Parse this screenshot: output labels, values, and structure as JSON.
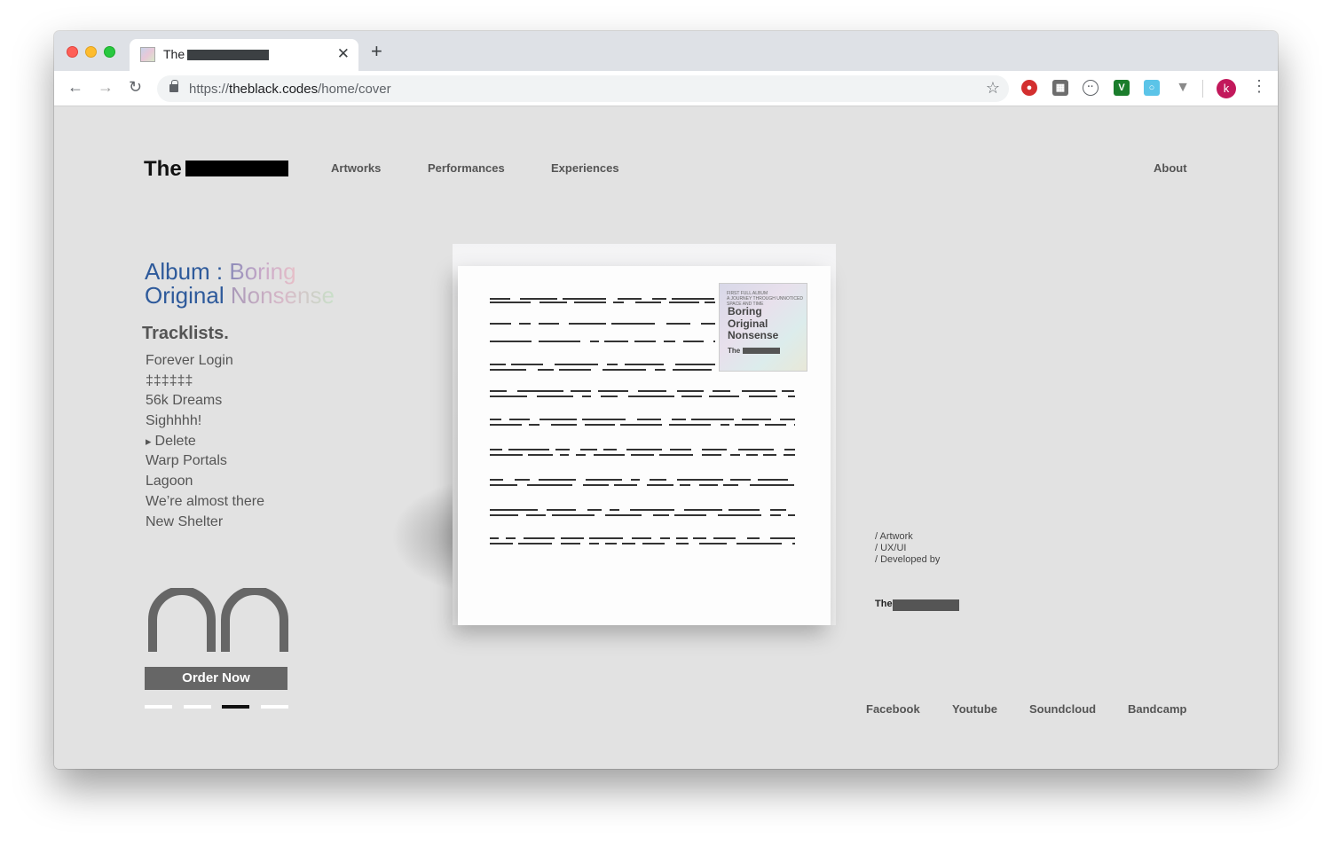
{
  "browser": {
    "tab_title": "The",
    "url_scheme": "https://",
    "url_host": "theblack.codes",
    "url_path": "/home/cover",
    "avatar_letter": "k"
  },
  "site": {
    "logo_text": "The",
    "nav": {
      "artworks": "Artworks",
      "performances": "Performances",
      "experiences": "Experiences",
      "about": "About"
    }
  },
  "album": {
    "label": "Album",
    "separator": " : ",
    "title_part1": "Boring",
    "title_part2": "Original",
    "title_part3": "Nonsense",
    "order_label": "Order Now"
  },
  "tracklist": {
    "heading": "Tracklists.",
    "tracks": [
      "Forever Login",
      "‡‡‡‡‡‡",
      "56k Dreams",
      "Sighhhh!",
      "Delete",
      "Warp Portals",
      "Lagoon",
      "We’re almost there",
      "New Shelter"
    ],
    "active_index": 4
  },
  "cover": {
    "sticker_line1": "FIRST FULL ALBUM",
    "sticker_line2": "A JOURNEY THROUGH UNNOTICED SPACE AND TIME",
    "sticker_title_1": "Boring",
    "sticker_title_2": "Original",
    "sticker_title_3": "Nonsense",
    "sticker_the": "The"
  },
  "credits": {
    "line1": "/ Artwork",
    "line2": "/ UX/UI",
    "line3": "/ Developed by",
    "the": "The"
  },
  "social": {
    "facebook": "Facebook",
    "youtube": "Youtube",
    "soundcloud": "Soundcloud",
    "bandcamp": "Bandcamp"
  },
  "carousel": {
    "count": 4,
    "active": 3
  },
  "colors": {
    "page_bg": "#e2e2e2",
    "album_blue": "#2e5a9b",
    "order_button": "#666666",
    "avatar": "#c2185b"
  }
}
